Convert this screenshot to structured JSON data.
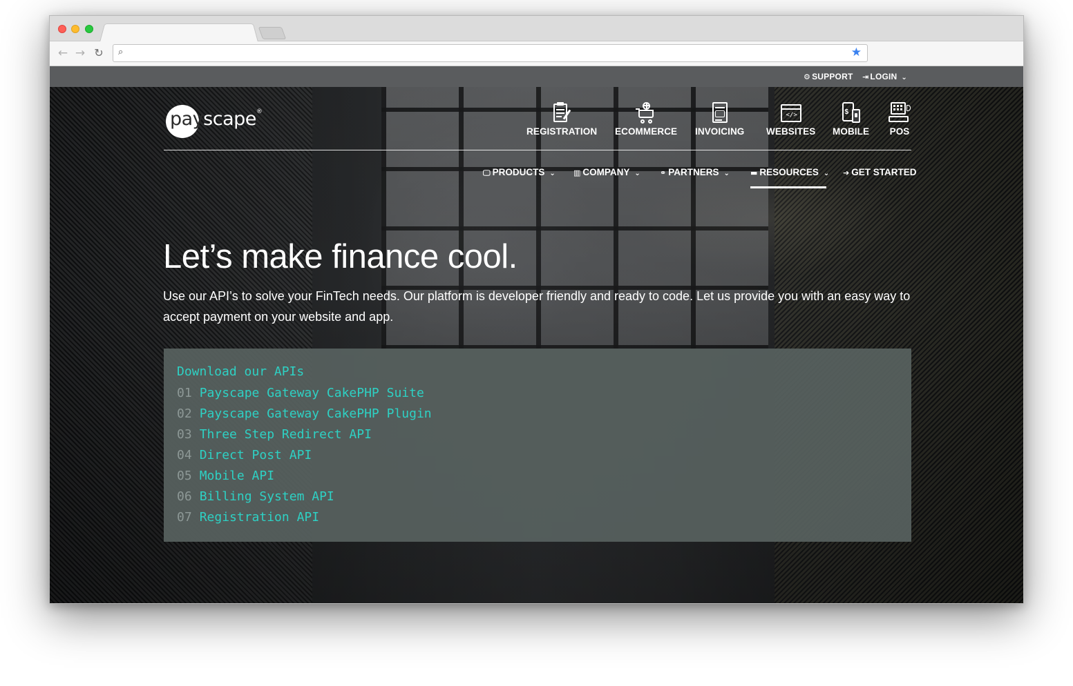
{
  "browser": {
    "address_value": "",
    "icons": [
      "back-arrow-icon",
      "forward-arrow-icon",
      "reload-icon",
      "search-icon",
      "bookmark-star-icon"
    ]
  },
  "utility_bar": {
    "support_label": "SUPPORT",
    "login_label": "LOGIN"
  },
  "logo": {
    "pay": "pay",
    "scape": "scape",
    "reg": "®"
  },
  "product_nav": [
    {
      "label": "REGISTRATION",
      "icon": "clipboard-icon"
    },
    {
      "label": "ECOMMERCE",
      "icon": "cart-icon"
    },
    {
      "label": "INVOICING",
      "icon": "invoice-icon"
    },
    {
      "label": "WEBSITES",
      "icon": "code-window-icon"
    },
    {
      "label": "MOBILE",
      "icon": "mobile-icon"
    },
    {
      "label": "POS",
      "icon": "pos-terminal-icon"
    }
  ],
  "main_nav": [
    {
      "label": "PRODUCTS",
      "icon": "monitor-icon",
      "dropdown": true
    },
    {
      "label": "COMPANY",
      "icon": "building-icon",
      "dropdown": true
    },
    {
      "label": "PARTNERS",
      "icon": "handshake-icon",
      "dropdown": true
    },
    {
      "label": "RESOURCES",
      "icon": "folder-icon",
      "dropdown": true,
      "active": true
    },
    {
      "label": "GET STARTED",
      "icon": "arrow-right-icon",
      "dropdown": false
    }
  ],
  "hero": {
    "headline": "Let’s make finance cool.",
    "subtext": "Use our API’s to solve your FinTech needs. Our platform is developer friendly and ready to code. Let us provide you with an easy way to accept payment on your website and app."
  },
  "api_box": {
    "title": "Download our APIs",
    "items": [
      {
        "num": "01",
        "label": "Payscape Gateway CakePHP Suite"
      },
      {
        "num": "02",
        "label": "Payscape Gateway CakePHP Plugin"
      },
      {
        "num": "03",
        "label": "Three Step Redirect API"
      },
      {
        "num": "04",
        "label": "Direct Post API"
      },
      {
        "num": "05",
        "label": "Mobile API"
      },
      {
        "num": "06",
        "label": "Billing System API"
      },
      {
        "num": "07",
        "label": "Registration API"
      }
    ]
  },
  "colors": {
    "accent_teal": "#2ed1c4",
    "utility_bar": "#5a5c5e",
    "code_box": "#586260"
  }
}
